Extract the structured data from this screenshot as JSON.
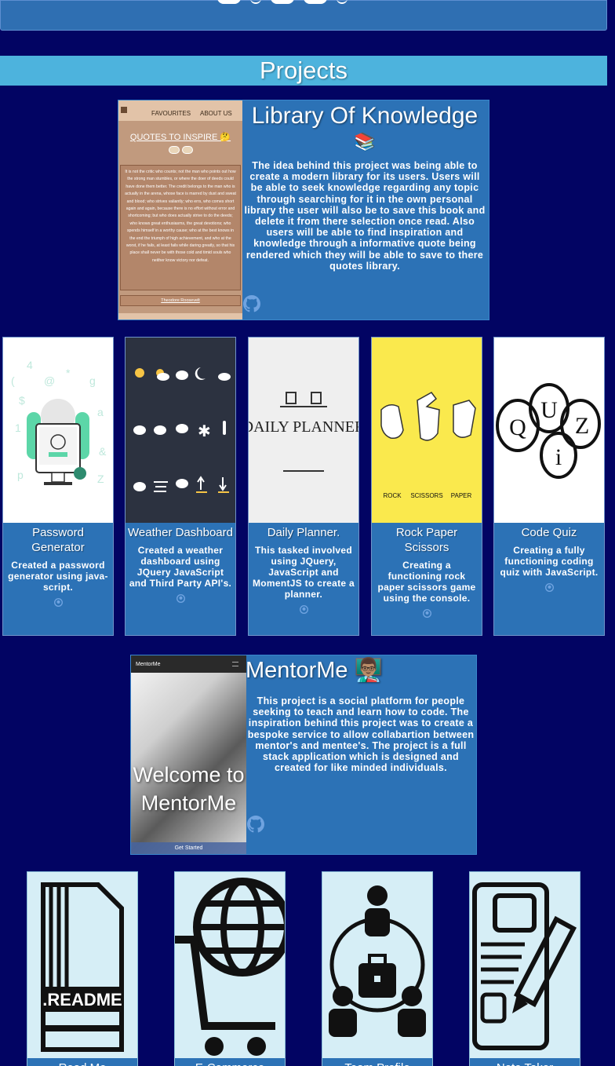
{
  "header": {
    "icons": [
      "linkedin-icon",
      "github-icon",
      "html-icon",
      "css-icon",
      "stack-icon"
    ]
  },
  "section": {
    "title": "Projects"
  },
  "library": {
    "title": "Library Of Knowledge",
    "emoji": "📚",
    "description": "The idea behind this project was being able to create a modern library for its users. Users will be able to seek knowledge regarding any topic through searching for it in the own personal library the user will also be to save this book and delete it from there selection once read. Also users will be able to find inspiration and knowledge through a informative quote being rendered which they will be able to save to there quotes library.",
    "screenshot": {
      "nav": [
        "FAVOURITES",
        "ABOUT US"
      ],
      "heading": "QUOTES TO INSPIRE 🤔",
      "quote": "It is not the critic who counts; not the man who points out how the strong man stumbles, or where the doer of deeds could have done them better. The credit belongs to the man who is actually in the arena, whose face is marred by dust and sweat and blood; who strives valiantly; who errs, who comes short again and again, because there is no effort without error and shortcoming; but who does actually strive to do the deeds; who knows great enthusiasms, the great devotions; who spends himself in a worthy cause; who at the best knows in the end the triumph of high achievement, and who at the worst, if he fails, at least fails while daring greatly, so that his place shall never be with those cold and timid souls who neither know victory nor defeat.",
      "author": "Theodore Roosevelt"
    }
  },
  "cards": [
    {
      "title": "Password Generator",
      "description": "Created a password generator using java-script."
    },
    {
      "title": "Weather Dashboard",
      "description": "Created a weather dashboard using JQuery JavaScript and Third Party API's."
    },
    {
      "title": "Daily Planner.",
      "description": "This tasked involved using JQuery, JavaScript and MomentJS to create a planner.",
      "image_text": "DAILY PLANNER"
    },
    {
      "title": "Rock Paper Scissors",
      "description": "Creating a functioning rock paper scissors game using the console.",
      "image_labels": [
        "ROCK",
        "SCISSORS",
        "PAPER"
      ]
    },
    {
      "title": "Code Quiz",
      "description": "Creating a fully functioning coding quiz with JavaScript.",
      "image_letters": [
        "Q",
        "U",
        "i",
        "Z"
      ]
    }
  ],
  "mentorme": {
    "title": "MentorMe 👨🏽‍🏫",
    "description": "This project is a social platform for people seeking to teach and learn how to code. The inspiration behind this project was to create a bespoke service to allow collabartion between mentor's and mentee's. The project is a full stack application which is designed and created for like minded individuals.",
    "screenshot": {
      "brand": "MentorMe",
      "welcome": "Welcome to MentorMe",
      "button": "Get Started"
    }
  },
  "bottom_cards": [
    {
      "title": "Read Me",
      "image_text": ".README"
    },
    {
      "title": "E-Commerce"
    },
    {
      "title": "Team Profile"
    },
    {
      "title": "Note Taker"
    }
  ],
  "colors": {
    "background": "#020463",
    "card": "#2c72b6",
    "header_band": "#4db3dd"
  }
}
